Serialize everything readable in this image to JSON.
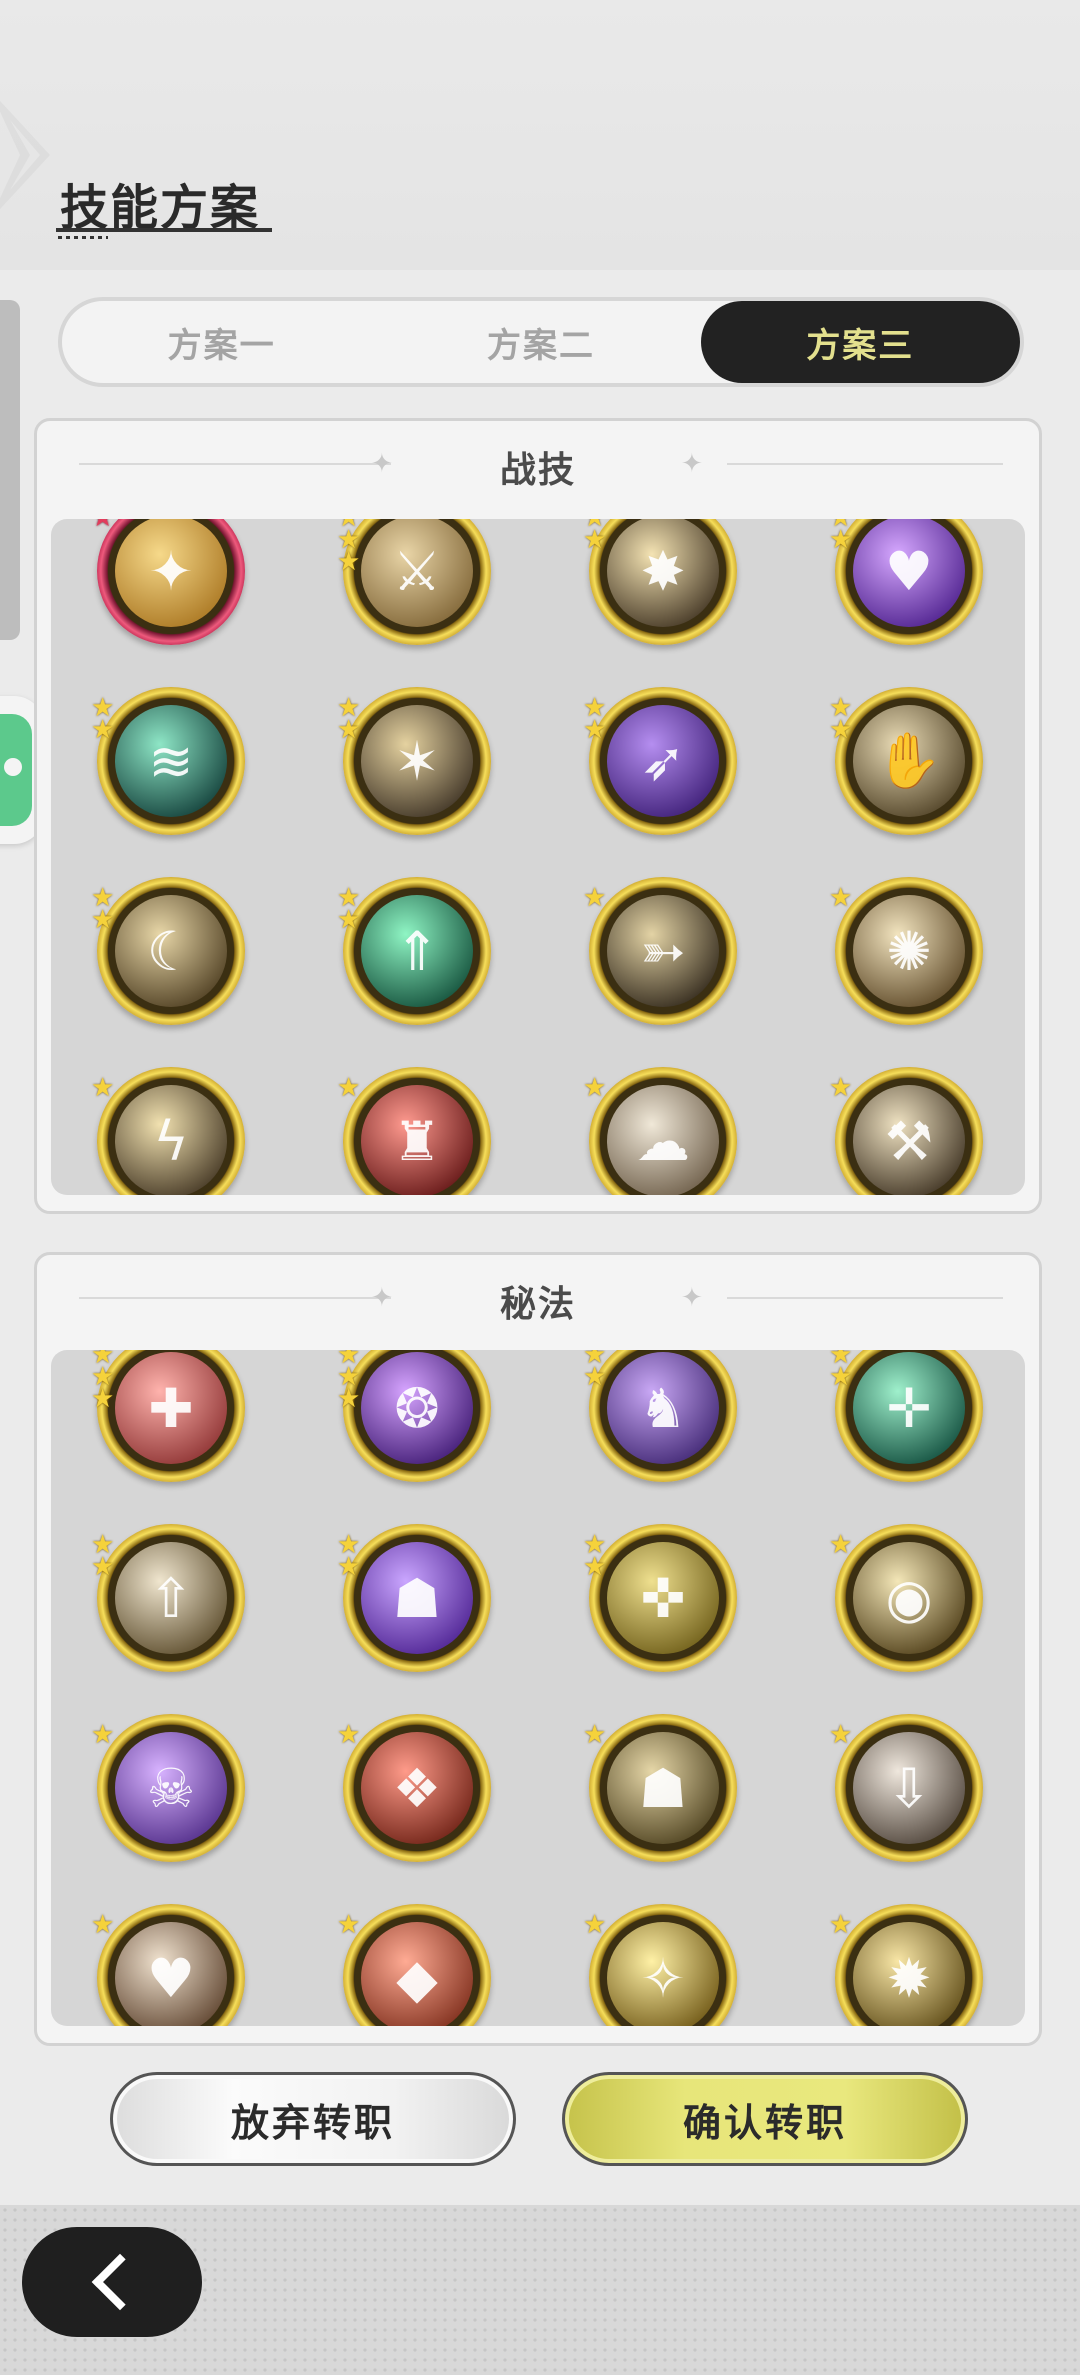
{
  "page": {
    "title": "技能方案"
  },
  "tabs": [
    {
      "label": "方案一",
      "active": false
    },
    {
      "label": "方案二",
      "active": false
    },
    {
      "label": "方案三",
      "active": true
    }
  ],
  "sections": {
    "combat": {
      "title": "战技",
      "skills": [
        {
          "icon": "golden-swirl-slash-icon",
          "stars": 1,
          "frame": "red",
          "colors": [
            "#f6d98a",
            "#a8741f"
          ]
        },
        {
          "icon": "sword-sparkle-icon",
          "stars": 3,
          "frame": "gold",
          "colors": [
            "#e9d5a7",
            "#7d6233"
          ]
        },
        {
          "icon": "burst-explosion-icon",
          "stars": 2,
          "frame": "gold",
          "colors": [
            "#f4e3b3",
            "#3e3120"
          ]
        },
        {
          "icon": "purple-heart-burst-icon",
          "stars": 2,
          "frame": "gold",
          "colors": [
            "#d6a8ff",
            "#4a1d8a"
          ]
        },
        {
          "icon": "teal-wave-slash-icon",
          "stars": 2,
          "frame": "gold",
          "colors": [
            "#8ee6c6",
            "#0f3b36"
          ]
        },
        {
          "icon": "claw-strikes-icon",
          "stars": 2,
          "frame": "gold",
          "colors": [
            "#e5d2a0",
            "#3a2f22"
          ]
        },
        {
          "icon": "purple-leap-icon",
          "stars": 2,
          "frame": "gold",
          "colors": [
            "#b58ef0",
            "#3a1b73"
          ]
        },
        {
          "icon": "hand-grab-icon",
          "stars": 2,
          "frame": "gold",
          "colors": [
            "#eadcb6",
            "#4b3d22"
          ]
        },
        {
          "icon": "crescent-blade-icon",
          "stars": 2,
          "frame": "gold",
          "colors": [
            "#e8d7a8",
            "#4a3a1e"
          ]
        },
        {
          "icon": "green-arrows-up-icon",
          "stars": 2,
          "frame": "gold",
          "colors": [
            "#8ff5c4",
            "#0f4a36"
          ]
        },
        {
          "icon": "dash-slash-icon",
          "stars": 1,
          "frame": "gold",
          "colors": [
            "#e3d3a5",
            "#2d2418"
          ]
        },
        {
          "icon": "whirlwind-icon",
          "stars": 1,
          "frame": "gold",
          "colors": [
            "#f2e4bf",
            "#5a4524"
          ]
        },
        {
          "icon": "lightning-slash-icon",
          "stars": 1,
          "frame": "gold",
          "colors": [
            "#f1e1b0",
            "#3f3220"
          ]
        },
        {
          "icon": "red-fighter-icon",
          "stars": 1,
          "frame": "gold",
          "colors": [
            "#ff9a8f",
            "#5e1212"
          ]
        },
        {
          "icon": "smoke-cloud-icon",
          "stars": 1,
          "frame": "gold",
          "colors": [
            "#f0e8d8",
            "#6a5a45"
          ]
        },
        {
          "icon": "hammer-strike-icon",
          "stars": 1,
          "frame": "gold",
          "colors": [
            "#efe2c2",
            "#3a2e1e"
          ]
        }
      ]
    },
    "arcana": {
      "title": "秘法",
      "skills": [
        {
          "icon": "sword-heal-icon",
          "stars": 3,
          "frame": "gold",
          "colors": [
            "#ffb3ad",
            "#8a2f2f"
          ]
        },
        {
          "icon": "purple-flame-icon",
          "stars": 3,
          "frame": "gold",
          "colors": [
            "#d6a4ff",
            "#3c1770"
          ]
        },
        {
          "icon": "raven-icon",
          "stars": 2,
          "frame": "gold",
          "colors": [
            "#c9a8f5",
            "#3d2470"
          ]
        },
        {
          "icon": "green-heal-plus-icon",
          "stars": 2,
          "frame": "gold",
          "colors": [
            "#9ff0cc",
            "#0e4a3a"
          ]
        },
        {
          "icon": "sword-up-icon",
          "stars": 2,
          "frame": "gold",
          "colors": [
            "#f0e6cf",
            "#5a4a2a"
          ]
        },
        {
          "icon": "purple-figure-up-icon",
          "stars": 2,
          "frame": "gold",
          "colors": [
            "#caa6ff",
            "#4a1f8f"
          ]
        },
        {
          "icon": "figure-heal-icon",
          "stars": 2,
          "frame": "gold",
          "colors": [
            "#efe08f",
            "#6b5a15"
          ]
        },
        {
          "icon": "all-seeing-eye-icon",
          "stars": 1,
          "frame": "gold",
          "colors": [
            "#f4e7b8",
            "#4c3b15"
          ]
        },
        {
          "icon": "purple-skull-icon",
          "stars": 1,
          "frame": "gold",
          "colors": [
            "#d8b3ff",
            "#4e2a86"
          ]
        },
        {
          "icon": "red-rune-icon",
          "stars": 1,
          "frame": "gold",
          "colors": [
            "#ff9b8a",
            "#6a1e12"
          ]
        },
        {
          "icon": "stone-golem-icon",
          "stars": 1,
          "frame": "gold",
          "colors": [
            "#e6d7a8",
            "#4a3e1c"
          ]
        },
        {
          "icon": "sword-down-icon",
          "stars": 1,
          "frame": "gold",
          "colors": [
            "#efe7dd",
            "#4b4036"
          ]
        },
        {
          "icon": "heart-shield-icon",
          "stars": 1,
          "frame": "gold",
          "colors": [
            "#f0e2cf",
            "#5a3f2a"
          ]
        },
        {
          "icon": "red-rune-stone-icon",
          "stars": 1,
          "frame": "gold",
          "colors": [
            "#ffab94",
            "#7a2a18"
          ]
        },
        {
          "icon": "golden-spirit-icon",
          "stars": 1,
          "frame": "gold",
          "colors": [
            "#fff1a6",
            "#6a5210"
          ]
        },
        {
          "icon": "golden-vortex-icon",
          "stars": 1,
          "frame": "gold",
          "colors": [
            "#f8e6a6",
            "#5a4713"
          ]
        }
      ]
    }
  },
  "buttons": {
    "abandon": "放弃转职",
    "confirm": "确认转职"
  },
  "nav": {
    "back_icon": "chevron-left-icon"
  }
}
